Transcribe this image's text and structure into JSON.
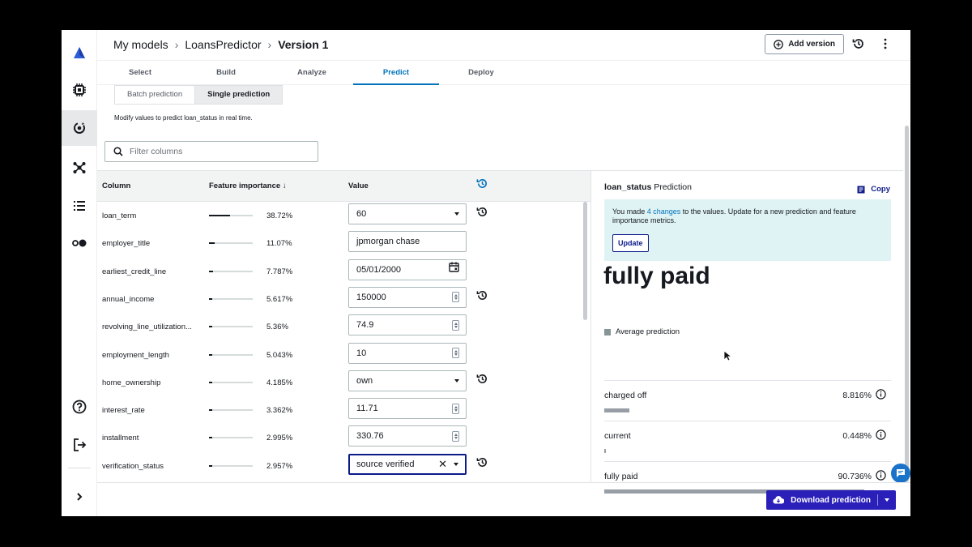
{
  "breadcrumb": {
    "root": "My models",
    "model": "LoansPredictor",
    "version": "Version 1"
  },
  "header": {
    "add_version_label": "Add version"
  },
  "tabs": [
    {
      "label": "Select"
    },
    {
      "label": "Build"
    },
    {
      "label": "Analyze"
    },
    {
      "label": "Predict",
      "active": true
    },
    {
      "label": "Deploy"
    }
  ],
  "prediction_mode": {
    "batch_label": "Batch prediction",
    "single_label": "Single prediction",
    "selected": "Single prediction"
  },
  "hint": "Modify values to predict loan_status in real time.",
  "search": {
    "placeholder": "Filter columns"
  },
  "table": {
    "col_column": "Column",
    "col_importance": "Feature importance",
    "col_value": "Value",
    "rows": [
      {
        "column": "loan_term",
        "importance": "38.72%",
        "importance_pct": 38.72,
        "value": "60",
        "kind": "select",
        "reset": true
      },
      {
        "column": "employer_title",
        "importance": "11.07%",
        "importance_pct": 11.07,
        "value": "jpmorgan chase",
        "kind": "text",
        "reset": false
      },
      {
        "column": "earliest_credit_line",
        "importance": "7.787%",
        "importance_pct": 7.787,
        "value": "05/01/2000",
        "kind": "date",
        "reset": false
      },
      {
        "column": "annual_income",
        "importance": "5.617%",
        "importance_pct": 5.617,
        "value": "150000",
        "kind": "number",
        "reset": true
      },
      {
        "column": "revolving_line_utilization...",
        "importance": "5.36%",
        "importance_pct": 5.36,
        "value": "74.9",
        "kind": "number",
        "reset": false
      },
      {
        "column": "employment_length",
        "importance": "5.043%",
        "importance_pct": 5.043,
        "value": "10",
        "kind": "number",
        "reset": false
      },
      {
        "column": "home_ownership",
        "importance": "4.185%",
        "importance_pct": 4.185,
        "value": "own",
        "kind": "select",
        "reset": true
      },
      {
        "column": "interest_rate",
        "importance": "3.362%",
        "importance_pct": 3.362,
        "value": "11.71",
        "kind": "number",
        "reset": false
      },
      {
        "column": "installment",
        "importance": "2.995%",
        "importance_pct": 2.995,
        "value": "330.76",
        "kind": "number",
        "reset": false
      },
      {
        "column": "verification_status",
        "importance": "2.957%",
        "importance_pct": 2.957,
        "value": "source verified",
        "kind": "select-clear",
        "reset": true
      }
    ]
  },
  "result": {
    "target": "loan_status",
    "suffix": "Prediction",
    "copy_label": "Copy",
    "alert_pre": "You made ",
    "alert_changes": "4 changes",
    "alert_post": " to the values. Update for a new prediction and feature importance metrics.",
    "update_label": "Update",
    "prediction": "fully paid",
    "average_label": "Average prediction",
    "classes": [
      {
        "name": "charged off",
        "prob": "8.816%",
        "pct": 8.816
      },
      {
        "name": "current",
        "prob": "0.448%",
        "pct": 0.448
      },
      {
        "name": "fully paid",
        "prob": "90.736%",
        "pct": 90.736
      }
    ]
  },
  "footer": {
    "download_label": "Download prediction"
  },
  "colors": {
    "accent": "#0073bb",
    "primary_button": "#2a1fb8",
    "alert_bg": "#dff3f4"
  }
}
